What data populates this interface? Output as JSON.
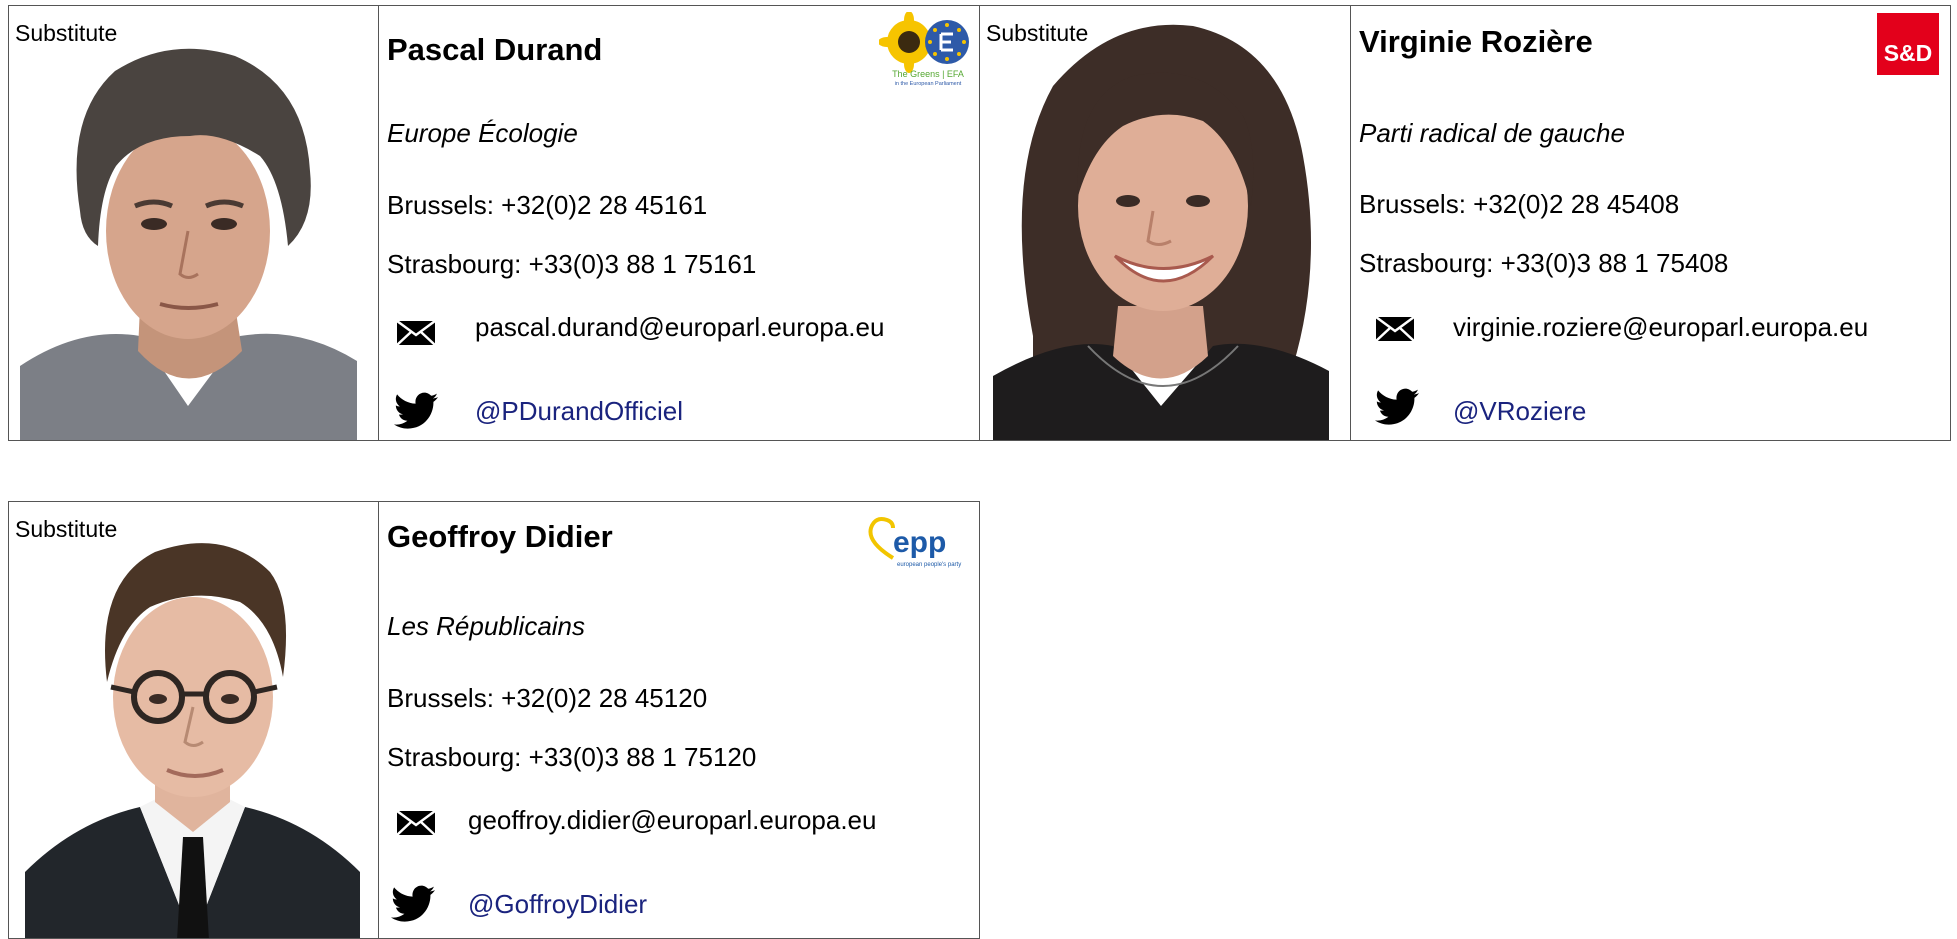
{
  "cards": [
    {
      "label": "Substitute",
      "name": "Pascal Durand",
      "party": "Europe Écologie",
      "brussels": "Brussels: +32(0)2 28 45161",
      "strasbourg": "Strasbourg: +33(0)3 88 1 75161",
      "email": "pascal.durand@europarl.europa.eu",
      "twitter": "@PDurandOfficiel",
      "logo_text": "The Greens | EFA",
      "logo_subtext": "in the European Parliament"
    },
    {
      "label": "Substitute",
      "name": "Virginie Rozière",
      "party": "Parti radical de gauche",
      "brussels": "Brussels: +32(0)2 28 45408",
      "strasbourg": "Strasbourg: +33(0)3 88 1 75408",
      "email": "virginie.roziere@europarl.europa.eu",
      "twitter": "@VRoziere",
      "logo_text": "S&D"
    },
    {
      "label": "Substitute",
      "name": "Geoffroy Didier",
      "party": "Les Républicains",
      "brussels": "Brussels: +32(0)2 28 45120",
      "strasbourg": "Strasbourg: +33(0)3 88 1 75120",
      "email": "geoffroy.didier@europarl.europa.eu",
      "twitter": "@GoffroyDidier",
      "logo_text": "epp",
      "logo_subtext": "european people's party"
    }
  ],
  "icons": {
    "email": "envelope-icon",
    "twitter": "twitter-bird-icon"
  },
  "colors": {
    "link": "#1a237e",
    "sd_red": "#e3001b",
    "epp_blue": "#1d5aa8",
    "epp_yellow": "#f2c500",
    "greens_green": "#56a833"
  }
}
